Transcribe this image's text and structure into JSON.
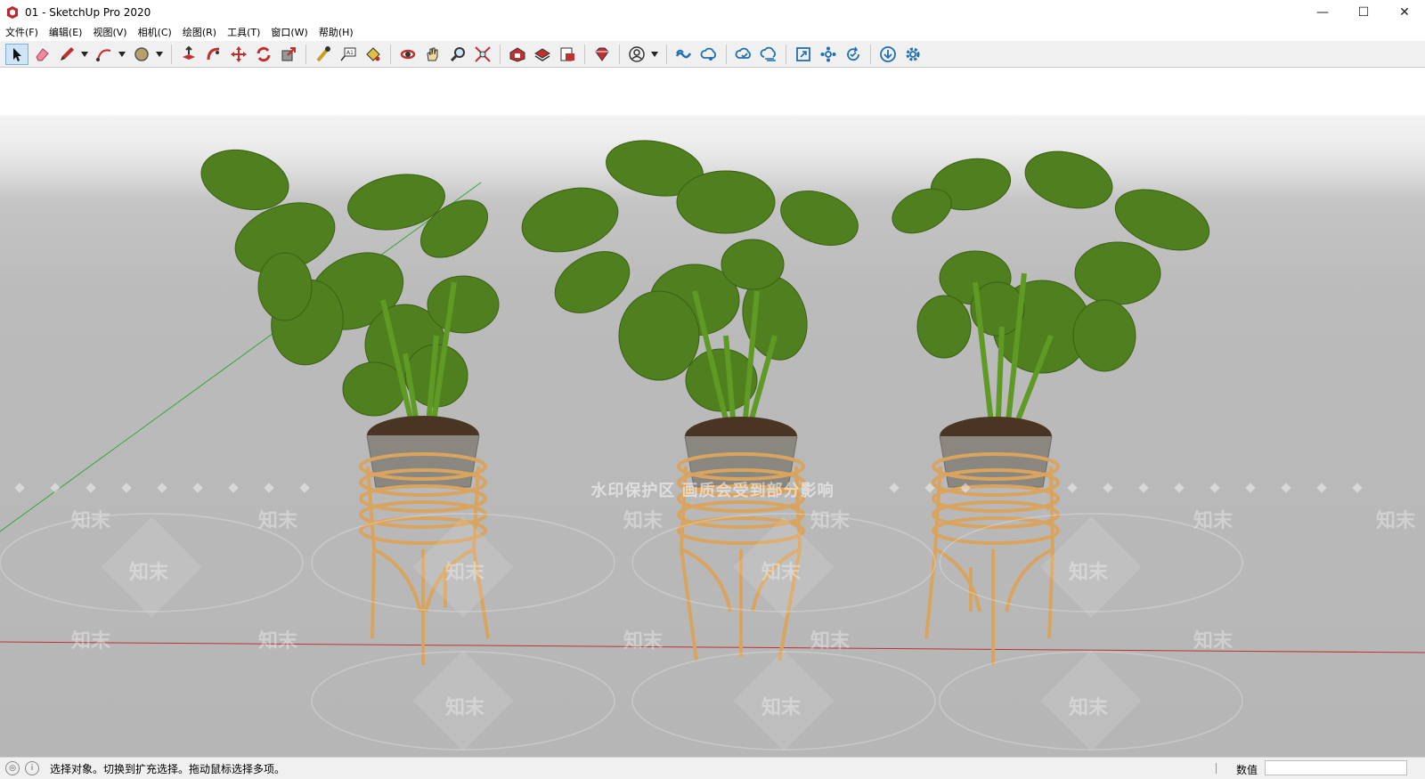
{
  "window": {
    "title": "01 - SketchUp Pro 2020",
    "min": "—",
    "max": "☐",
    "close": "✕"
  },
  "menu": [
    "文件(F)",
    "编辑(E)",
    "视图(V)",
    "相机(C)",
    "绘图(R)",
    "工具(T)",
    "窗口(W)",
    "帮助(H)"
  ],
  "toolbar": {
    "tools": [
      "select-tool",
      "eraser-tool",
      "line-tool",
      "arc-tool",
      "shapes-tool",
      "push-pull-tool",
      "follow-me-tool",
      "move-tool",
      "rotate-tool",
      "scale-tool",
      "tape-measure-tool",
      "text-tool",
      "paint-bucket-tool",
      "orbit-tool",
      "pan-tool",
      "zoom-tool",
      "zoom-extents-tool",
      "warehouse-tool",
      "extension-warehouse-tool",
      "layout-tool",
      "ruby-tool",
      "account-tool",
      "trimble-connect-tool",
      "trimble-share-tool",
      "cloud-sync-tool",
      "cloud-upload-tool",
      "fullscreen-tool",
      "components-tool",
      "refresh-tool",
      "download-tool",
      "settings-tool"
    ]
  },
  "viewport": {
    "watermark_text": "水印保护区   画质会受到部分影响",
    "watermark_tile": "知末",
    "colors": {
      "red_axis": "#c0302f",
      "green_axis": "#2ea83a",
      "leaf": "#4f7f1e",
      "stand": "#d9a45f",
      "pot": "#8a8680"
    }
  },
  "status": {
    "hint": "选择对象。切换到扩充选择。拖动鼠标选择多项。",
    "measure_label": "数值",
    "measure_value": ""
  }
}
